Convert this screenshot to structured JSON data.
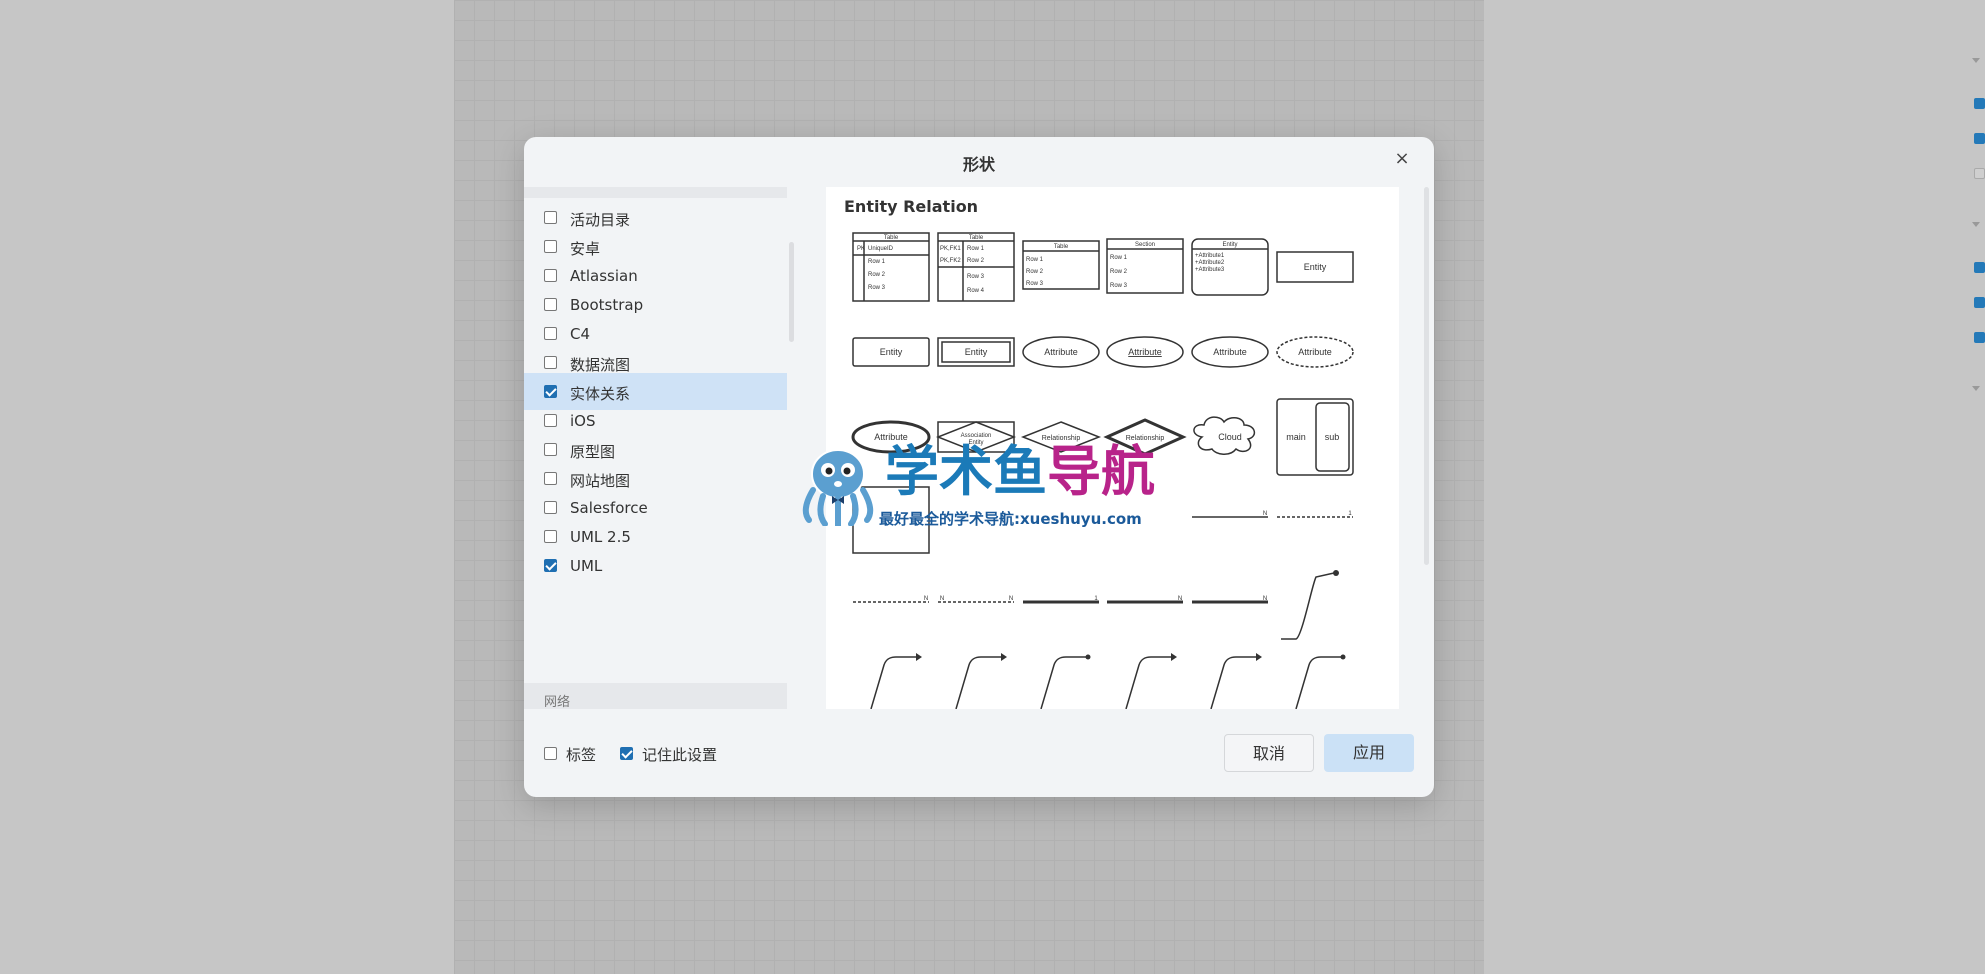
{
  "dialog": {
    "title": "形状",
    "close_icon": "close-icon",
    "close_glyph": "×"
  },
  "categories": [
    {
      "label": "活动目录",
      "checked": false,
      "selected": false
    },
    {
      "label": "安卓",
      "checked": false,
      "selected": false
    },
    {
      "label": "Atlassian",
      "checked": false,
      "selected": false
    },
    {
      "label": "Bootstrap",
      "checked": false,
      "selected": false
    },
    {
      "label": "C4",
      "checked": false,
      "selected": false
    },
    {
      "label": "数据流图",
      "checked": false,
      "selected": false
    },
    {
      "label": "实体关系",
      "checked": true,
      "selected": true
    },
    {
      "label": "iOS",
      "checked": false,
      "selected": false
    },
    {
      "label": "原型图",
      "checked": false,
      "selected": false
    },
    {
      "label": "网站地图",
      "checked": false,
      "selected": false
    },
    {
      "label": "Salesforce",
      "checked": false,
      "selected": false
    },
    {
      "label": "UML 2.5",
      "checked": false,
      "selected": false
    },
    {
      "label": "UML",
      "checked": true,
      "selected": false
    }
  ],
  "group_next": "网络",
  "preview": {
    "title": "Entity Relation",
    "labels": {
      "table": "Table",
      "pk": "PK",
      "unique_id": "UniqueID",
      "pk_fk1": "PK,FK1",
      "pk_fk2": "PK,FK2",
      "row1": "Row 1",
      "row2": "Row 2",
      "row3": "Row 3",
      "row4": "Row 4",
      "section": "Section",
      "entity": "Entity",
      "attr1": "+Attribute1",
      "attr2": "+Attribute2",
      "attr3": "+Attribute3",
      "attribute": "Attribute",
      "association": "Association",
      "relationship": "Relationship",
      "cloud": "Cloud",
      "main": "main",
      "sub": "sub",
      "one": "1",
      "n": "N"
    }
  },
  "footer": {
    "tags_label": "标签",
    "tags_checked": false,
    "remember_label": "记住此设置",
    "remember_checked": true,
    "cancel_label": "取消",
    "apply_label": "应用"
  },
  "watermark": {
    "title_part1": "学术鱼",
    "title_part2": "导航",
    "subtitle": "最好最全的学术导航:xueshuyu.com",
    "color_primary": "#1b7ab8",
    "color_secondary": "#b8238a"
  }
}
